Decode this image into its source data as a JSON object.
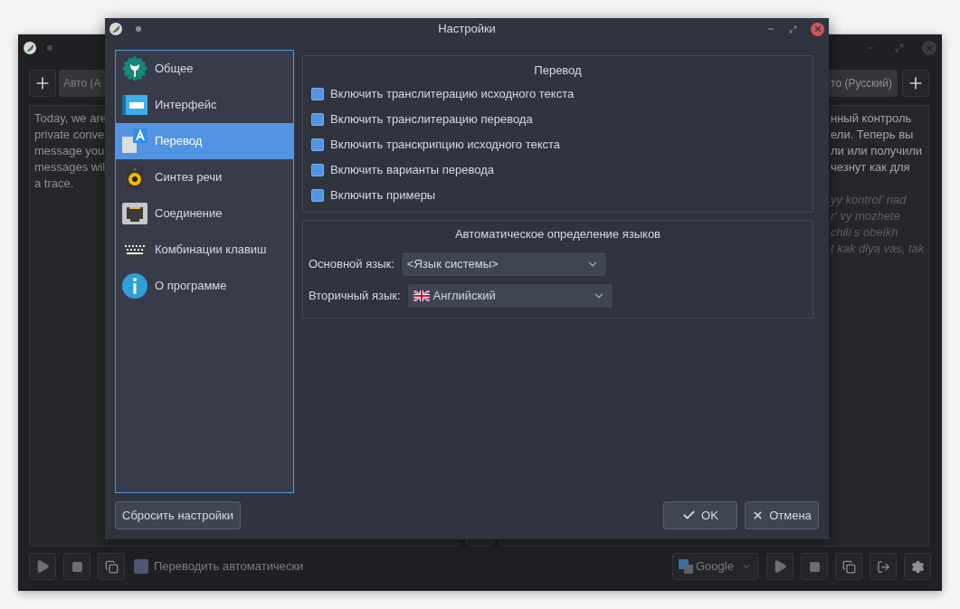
{
  "main_window": {
    "source_language": "Авто (А",
    "target_language": "то (Русский)",
    "source_text": [
      "Today, we are",
      "private conve",
      "message you",
      "messages wil",
      "a trace."
    ],
    "translation_text": [
      "нный контроль",
      "ели. Теперь вы",
      "ли или получили",
      "чезнут как для"
    ],
    "translation_transliteration": [
      "yy kontrol' nad",
      "r' vy mozhete",
      "chili s obeikh",
      "t kak dlya vas, tak"
    ],
    "auto_translate": {
      "label": "Переводить автоматически",
      "checked": true
    },
    "engine": "Google"
  },
  "dialog": {
    "title": "Настройки",
    "sidebar": {
      "items": [
        {
          "label": "Общее",
          "selected": false
        },
        {
          "label": "Интерфейс",
          "selected": false
        },
        {
          "label": "Перевод",
          "selected": true
        },
        {
          "label": "Синтез речи",
          "selected": false
        },
        {
          "label": "Соединение",
          "selected": false
        },
        {
          "label": "Комбинации клавиш",
          "selected": false
        },
        {
          "label": "О программе",
          "selected": false
        }
      ]
    },
    "translation_group": {
      "title": "Перевод",
      "options": [
        {
          "label": "Включить транслитерацию исходного текста",
          "checked": true
        },
        {
          "label": "Включить транслитерацию перевода",
          "checked": true
        },
        {
          "label": "Включить транскрипцию исходного текста",
          "checked": true
        },
        {
          "label": "Включить варианты перевода",
          "checked": true
        },
        {
          "label": "Включить примеры",
          "checked": true
        }
      ]
    },
    "autodetect_group": {
      "title": "Автоматическое определение языков",
      "fields": [
        {
          "label": "Основной язык:",
          "value": "<Язык системы>"
        },
        {
          "label": "Вторичный язык:",
          "value": "Английский"
        }
      ]
    },
    "buttons": {
      "reset": "Сбросить настройки",
      "ok": "OK",
      "cancel": "Отмена"
    }
  }
}
